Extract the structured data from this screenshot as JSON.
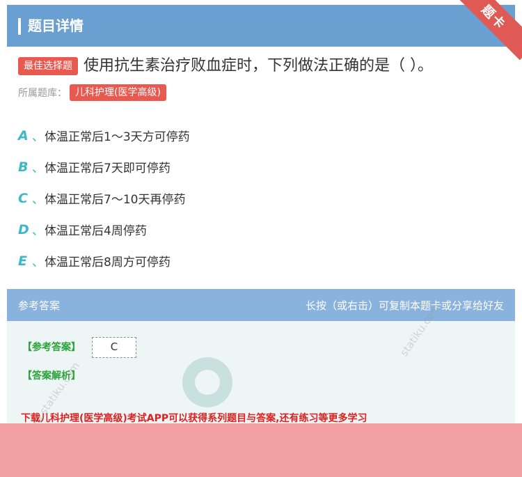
{
  "header": {
    "title": "题目详情",
    "corner_label": "题卡"
  },
  "question": {
    "type_badge": "最佳选择题",
    "text": "使用抗生素治疗败血症时，下列做法正确的是（  ）。",
    "bank_label": "所属题库：",
    "bank_name": "儿科护理(医学高级)"
  },
  "options": [
    {
      "letter": "A",
      "sep": "、",
      "text": "体温正常后1～3天方可停药"
    },
    {
      "letter": "B",
      "sep": "、",
      "text": "体温正常后7天即可停药"
    },
    {
      "letter": "C",
      "sep": "、",
      "text": "体温正常后7～10天再停药"
    },
    {
      "letter": "D",
      "sep": "、",
      "text": "体温正常后4周停药"
    },
    {
      "letter": "E",
      "sep": "、",
      "text": "体温正常后8周方可停药"
    }
  ],
  "answer": {
    "header_title": "参考答案",
    "header_hint": "长按（或右击）可复制本题卡或分享给好友",
    "ref_label": "【参考答案】",
    "ref_value": "C",
    "analysis_label": "【答案解析】"
  },
  "promo_text": "下载儿科护理(医学高级)考试APP可以获得系列题目与答案,还有练习等更多学习",
  "watermarks": [
    "ww.statiku.com",
    "statiku.com"
  ],
  "colors": {
    "header": "#6a9fd2",
    "badge": "#e85a50",
    "option_letter": "#3cb8c6",
    "answer_label": "#2aa33a"
  }
}
